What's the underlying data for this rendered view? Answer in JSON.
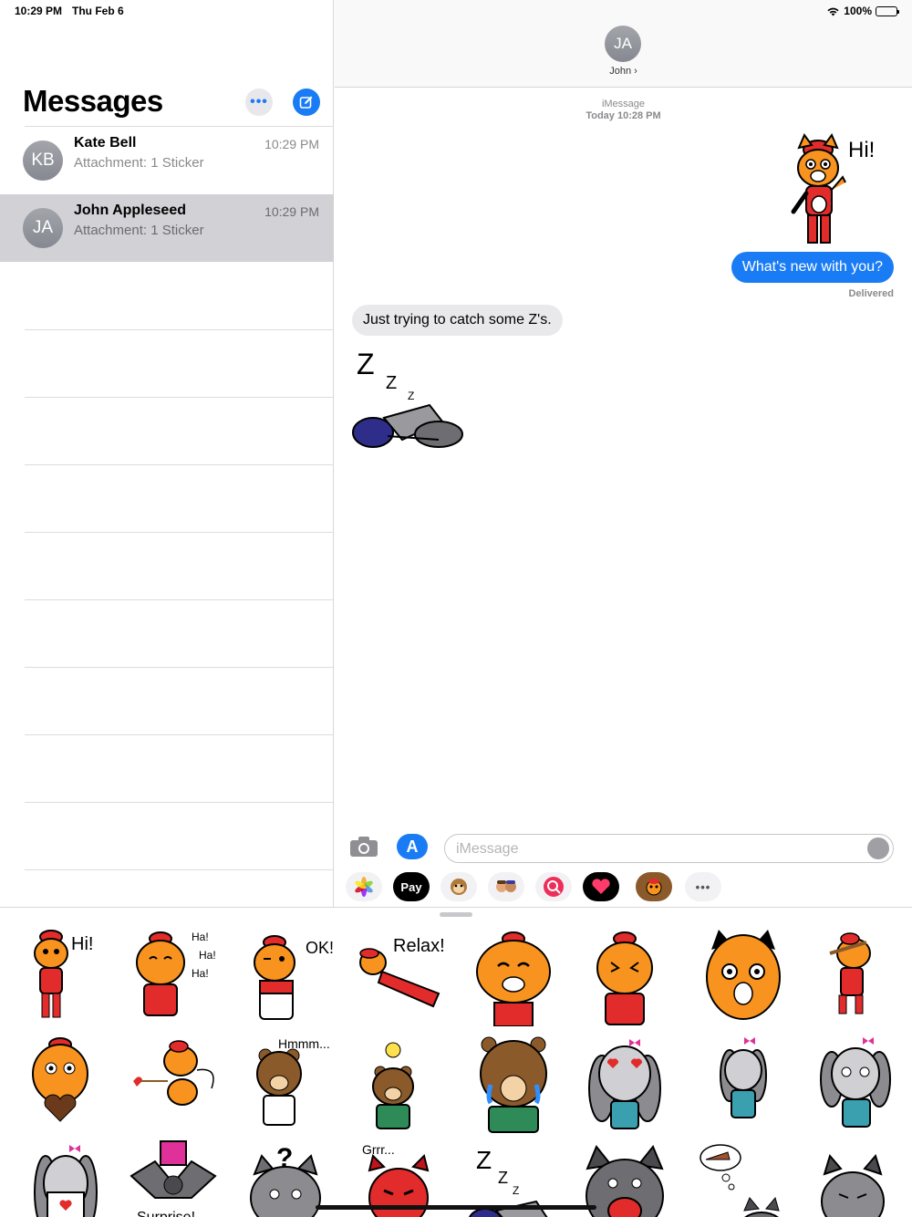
{
  "status": {
    "time": "10:29 PM",
    "date": "Thu Feb 6",
    "battery": "100%"
  },
  "sidebar": {
    "title": "Messages",
    "more_label": "•••",
    "conversations": [
      {
        "initials": "KB",
        "name": "Kate Bell",
        "preview": "Attachment: 1 Sticker",
        "time": "10:29 PM"
      },
      {
        "initials": "JA",
        "name": "John Appleseed",
        "preview": "Attachment: 1 Sticker",
        "time": "10:29 PM"
      }
    ]
  },
  "chat": {
    "header_initials": "JA",
    "header_name": "John ›",
    "service": "iMessage",
    "timestamp": "Today 10:28 PM",
    "sticker_hi_text": "Hi!",
    "outgoing": "What's new with you?",
    "delivered": "Delivered",
    "incoming": "Just trying to catch some Z's.",
    "sticker_z": [
      "Z",
      "Z",
      "Z"
    ],
    "input_placeholder": "iMessage",
    "apple_pay": "Pay",
    "more_apps": "•••"
  },
  "drawer": {
    "captions": {
      "hi": "Hi!",
      "ha1": "Ha!",
      "ha2": "Ha!",
      "ha3": "Ha!",
      "ok": "OK!",
      "relax": "Relax!",
      "hmmm": "Hmmm...",
      "grrr": "Grrr...",
      "question": "?",
      "surprise": "Surprise!",
      "z1": "Z",
      "z2": "Z",
      "z3": "Z"
    }
  },
  "colors": {
    "accent": "#1a7cf5",
    "cat_orange": "#f7931e",
    "shirt_red": "#e22b2b",
    "bunny_gray": "#8c8c90",
    "bear_brown": "#8a5a2b"
  }
}
